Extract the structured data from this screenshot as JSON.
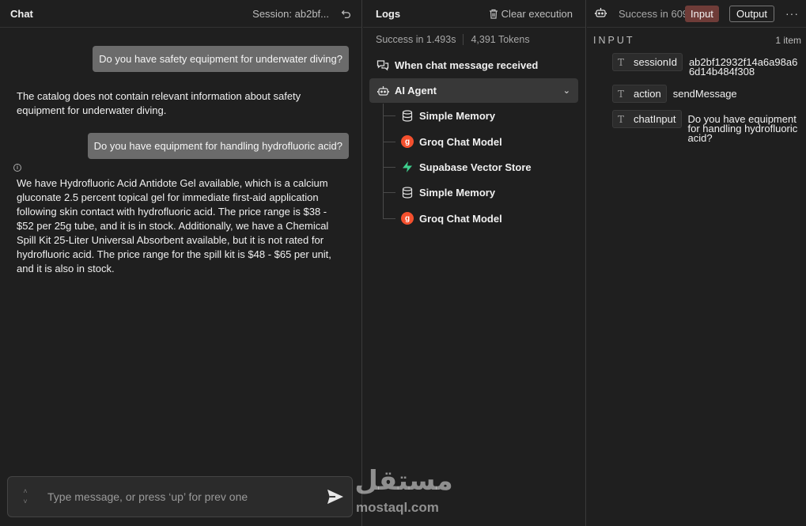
{
  "chat": {
    "title": "Chat",
    "session": "Session: ab2bf...",
    "messages": [
      {
        "role": "user",
        "text": "Do you have safety equipment for underwater diving?"
      },
      {
        "role": "bot",
        "text": "The catalog does not contain relevant information about safety equipment for underwater diving."
      },
      {
        "role": "user",
        "text": "Do you have equipment for handling hydrofluoric acid?"
      },
      {
        "role": "bot",
        "text": "We have Hydrofluoric Acid Antidote Gel available, which is a calcium gluconate 2.5 percent topical gel for immediate first-aid application following skin contact with hydrofluoric acid. The price range is $38 - $52 per 25g tube, and it is in stock. Additionally, we have a Chemical Spill Kit 25-Liter Universal Absorbent available, but it is not rated for hydrofluoric acid. The price range for the spill kit is $48 - $65 per unit, and it is also in stock."
      }
    ],
    "info_glyph": "i",
    "composer": {
      "placeholder": "Type message, or press ‘up’ for prev one",
      "up_glyph": "˄",
      "down_glyph": "˅"
    }
  },
  "logs": {
    "title": "Logs",
    "clear_label": "Clear execution",
    "success": "Success in 1.493s",
    "tokens": "4,391 Tokens",
    "trigger": "When chat message received",
    "agent": "AI Agent",
    "chevron": "⌄",
    "sub_items": [
      {
        "label": "Simple Memory",
        "icon": "database-icon"
      },
      {
        "label": "Groq Chat Model",
        "icon": "groq-icon",
        "glyph": "g"
      },
      {
        "label": "Supabase Vector Store",
        "icon": "supabase-icon"
      },
      {
        "label": "Simple Memory",
        "icon": "database-icon"
      },
      {
        "label": "Groq Chat Model",
        "icon": "groq-icon",
        "glyph": "g"
      }
    ]
  },
  "details": {
    "status": "Success in 609",
    "tab_input": "Input",
    "tab_output": "Output",
    "more": "···",
    "heading": "INPUT",
    "count": "1 item",
    "type_glyph": "T",
    "fields": [
      {
        "key": "sessionId",
        "value": "ab2bf12932f14a6a98a66d14b484f308"
      },
      {
        "key": "action",
        "value": "sendMessage"
      },
      {
        "key": "chatInput",
        "value": "Do you have equipment for handling hydrofluoric acid?"
      }
    ]
  },
  "watermark": {
    "arabic": "مستقل",
    "latin": "mostaql.com"
  },
  "colors": {
    "panel": "#1f1f1f",
    "user_bubble": "#6b6b6b",
    "input_tab": "#6f3c38",
    "groq": "#f4502e",
    "supabase": "#3ecf8e"
  }
}
